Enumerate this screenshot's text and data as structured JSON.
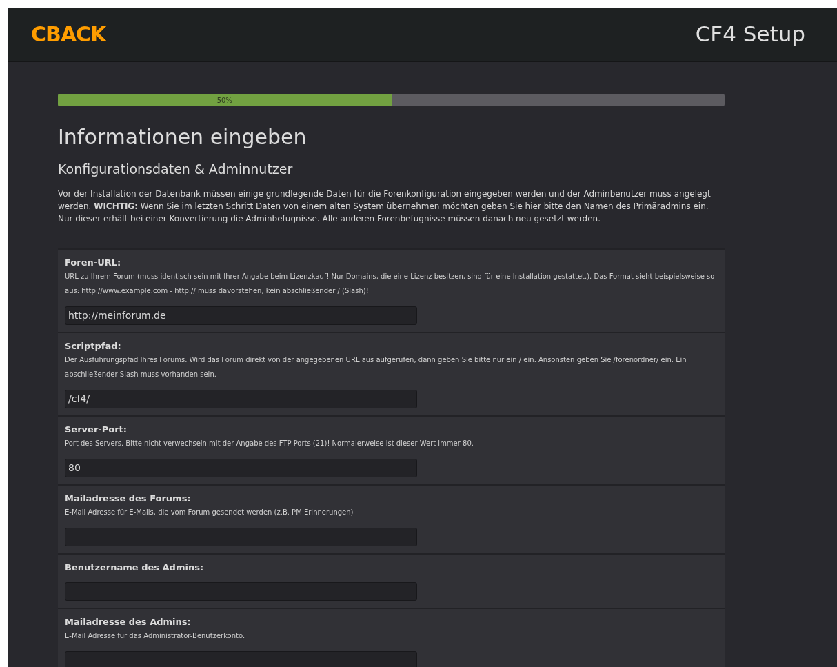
{
  "header": {
    "logo": "CBACK",
    "title": "CF4 Setup"
  },
  "progress": {
    "level": 0.5,
    "label": "50%"
  },
  "heading": "Informationen eingeben",
  "subheading": "Konfigurationsdaten & Adminnutzer",
  "intro": "Vor der Installation der Datenbank müssen einige grundlegende Daten für die Forenkonfiguration eingegeben werden und der Adminbenutzer muss angelegt werden. **WICHTIG:** Wenn Sie im letzten Schritt Daten von einem alten System übernehmen möchten geben Sie hier bitte den Namen des Primäradmins ein. Nur dieser erhält bei einer Konvertierung die Adminbefugnisse. Alle anderen Forenbefugnisse müssen danach neu gesetzt werden.",
  "fields": [
    {
      "label": "Foren-URL:",
      "description": "URL zu Ihrem Forum (muss identisch sein mit Ihrer Angabe beim Lizenzkauf! Nur Domains, die eine Lizenz besitzen, sind für eine Installation gestattet.). Das Format sieht beispielsweise so aus: http://www.example.com - http:// muss davorstehen, kein abschließender / (Slash)!",
      "value": "http://meinforum.de"
    },
    {
      "label": "Scriptpfad:",
      "description": "Der Ausführungspfad Ihres Forums. Wird das Forum direkt von der angegebenen URL aus aufgerufen, dann geben Sie bitte nur ein / ein. Ansonsten geben Sie /forenordner/ ein. Ein abschließender Slash muss vorhanden sein.",
      "value": "/cf4/"
    },
    {
      "label": "Server-Port:",
      "description": "Port des Servers. Bitte nicht verwechseln mit der Angabe des FTP Ports (21)! Normalerweise ist dieser Wert immer 80.",
      "value": "80"
    },
    {
      "label": "Mailadresse des Forums:",
      "description": "E-Mail Adresse für E-Mails, die vom Forum gesendet werden (z.B. PM Erinnerungen)"
    },
    {
      "label": "Benutzername des Admins:"
    },
    {
      "label": "Mailadresse des Admins:",
      "description": "E-Mail Adresse für das Administrator-Benutzerkonto."
    }
  ]
}
